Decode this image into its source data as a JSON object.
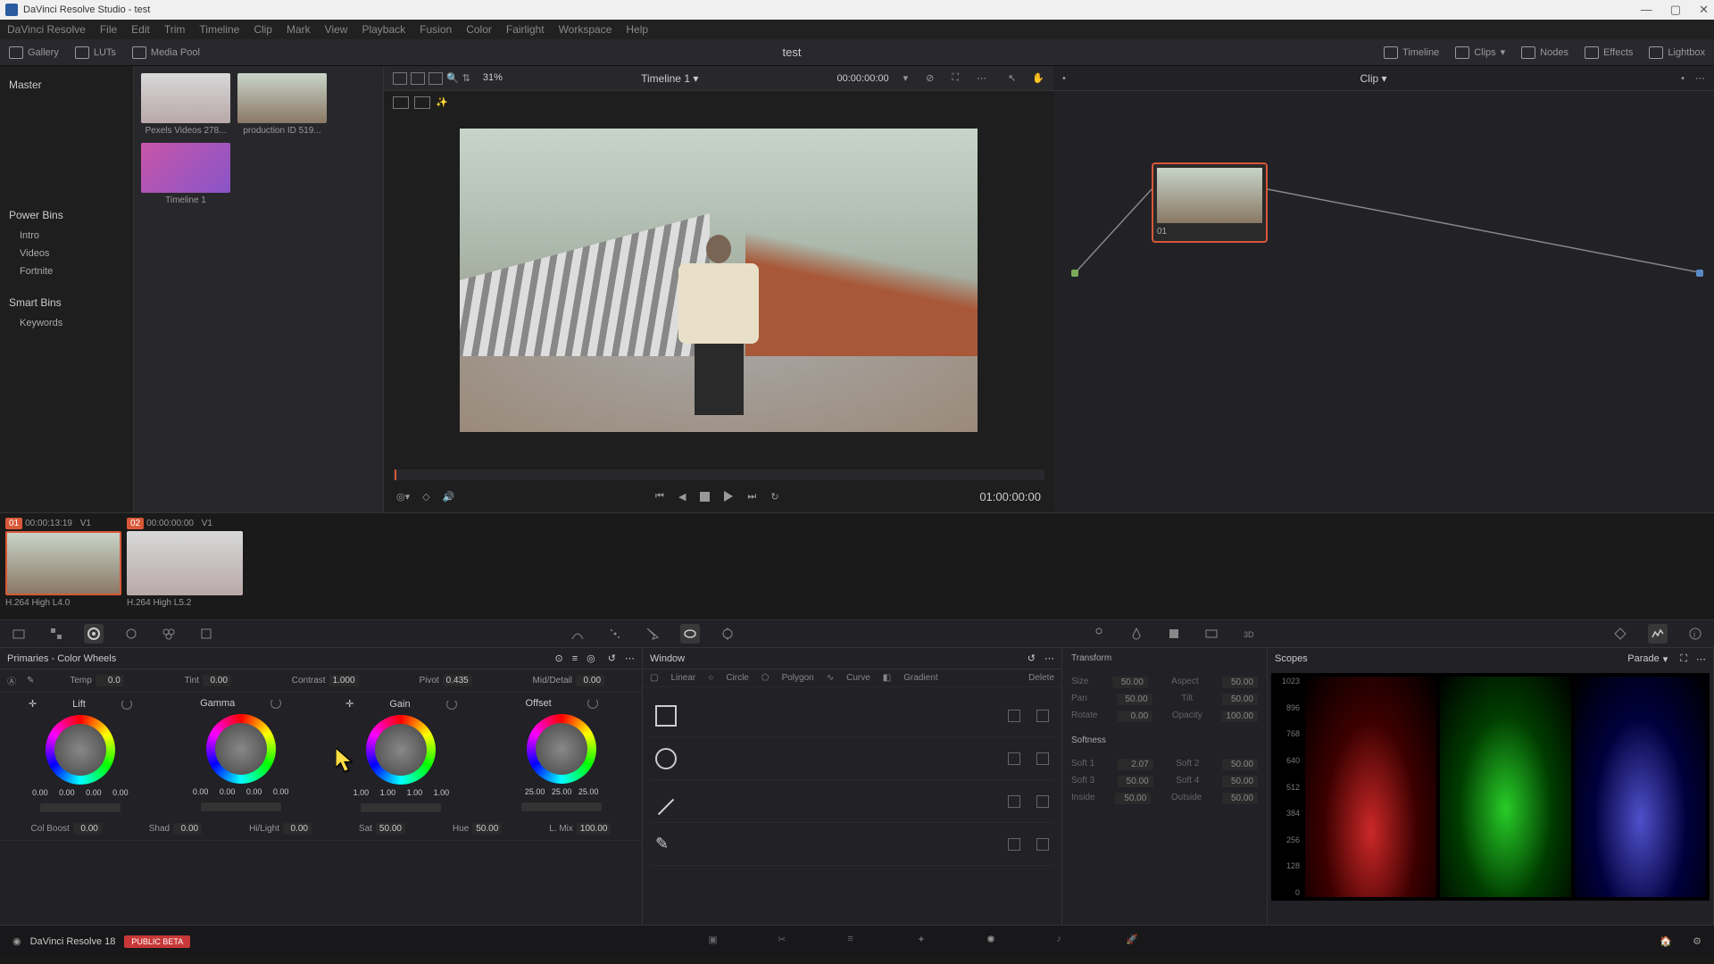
{
  "titlebar": {
    "app_name": "DaVinci Resolve Studio",
    "project": "test"
  },
  "menu": [
    "DaVinci Resolve",
    "File",
    "Edit",
    "Trim",
    "Timeline",
    "Clip",
    "Mark",
    "View",
    "Playback",
    "Fusion",
    "Color",
    "Fairlight",
    "Workspace",
    "Help"
  ],
  "toolbar": {
    "gallery": "Gallery",
    "luts": "LUTs",
    "media_pool": "Media Pool",
    "project_title": "test",
    "timeline": "Timeline",
    "clips": "Clips",
    "nodes": "Nodes",
    "effects": "Effects",
    "lightbox": "Lightbox"
  },
  "left_panel": {
    "master": "Master",
    "power_bins_title": "Power Bins",
    "power_bins": [
      "Intro",
      "Videos",
      "Fortnite"
    ],
    "smart_bins_title": "Smart Bins",
    "smart_bins": [
      "Keywords"
    ]
  },
  "media_pool": {
    "clips": [
      {
        "name": "Pexels Videos 278..."
      },
      {
        "name": "production ID 519..."
      }
    ],
    "timeline_name": "Timeline 1"
  },
  "viewer": {
    "zoom": "31%",
    "timeline_name": "Timeline 1",
    "timecode_top": "00:00:00:00",
    "timecode_play": "01:00:00:00"
  },
  "node_editor": {
    "title": "Clip",
    "node_label": "01"
  },
  "timeline_clips": [
    {
      "num": "01",
      "tc": "00:00:13:19",
      "v": "V1",
      "codec": "H.264 High L4.0"
    },
    {
      "num": "02",
      "tc": "00:00:00:00",
      "v": "V1",
      "codec": "H.264 High L5.2"
    }
  ],
  "primaries": {
    "title": "Primaries - Color Wheels",
    "params_top": [
      {
        "label": "Temp",
        "val": "0.0"
      },
      {
        "label": "Tint",
        "val": "0.00"
      },
      {
        "label": "Contrast",
        "val": "1.000"
      },
      {
        "label": "Pivot",
        "val": "0.435"
      },
      {
        "label": "Mid/Detail",
        "val": "0.00"
      }
    ],
    "wheels": [
      {
        "name": "Lift",
        "values": [
          "0.00",
          "0.00",
          "0.00",
          "0.00"
        ]
      },
      {
        "name": "Gamma",
        "values": [
          "0.00",
          "0.00",
          "0.00",
          "0.00"
        ]
      },
      {
        "name": "Gain",
        "values": [
          "1.00",
          "1.00",
          "1.00",
          "1.00"
        ]
      },
      {
        "name": "Offset",
        "values": [
          "25.00",
          "25.00",
          "25.00"
        ]
      }
    ],
    "params_bottom": [
      {
        "label": "Col Boost",
        "val": "0.00"
      },
      {
        "label": "Shad",
        "val": "0.00"
      },
      {
        "label": "Hi/Light",
        "val": "0.00"
      },
      {
        "label": "Sat",
        "val": "50.00"
      },
      {
        "label": "Hue",
        "val": "50.00"
      },
      {
        "label": "L. Mix",
        "val": "100.00"
      }
    ]
  },
  "window_panel": {
    "title": "Window",
    "tabs": [
      "Linear",
      "Circle",
      "Polygon",
      "Curve",
      "Gradient"
    ],
    "delete": "Delete"
  },
  "transform": {
    "title": "Transform",
    "rows1": [
      {
        "l1": "Size",
        "v1": "50.00",
        "l2": "Aspect",
        "v2": "50.00"
      },
      {
        "l1": "Pan",
        "v1": "50.00",
        "l2": "Tilt",
        "v2": "50.00"
      },
      {
        "l1": "Rotate",
        "v1": "0.00",
        "l2": "Opacity",
        "v2": "100.00"
      }
    ],
    "softness_title": "Softness",
    "rows2": [
      {
        "l1": "Soft 1",
        "v1": "2.07",
        "l2": "Soft 2",
        "v2": "50.00"
      },
      {
        "l1": "Soft 3",
        "v1": "50.00",
        "l2": "Soft 4",
        "v2": "50.00"
      },
      {
        "l1": "Inside",
        "v1": "50.00",
        "l2": "Outside",
        "v2": "50.00"
      }
    ]
  },
  "scopes": {
    "title": "Scopes",
    "mode": "Parade",
    "axis": [
      "1023",
      "896",
      "768",
      "640",
      "512",
      "384",
      "256",
      "128",
      "0"
    ]
  },
  "footer": {
    "app": "DaVinci Resolve 18",
    "badge": "PUBLIC BETA"
  }
}
